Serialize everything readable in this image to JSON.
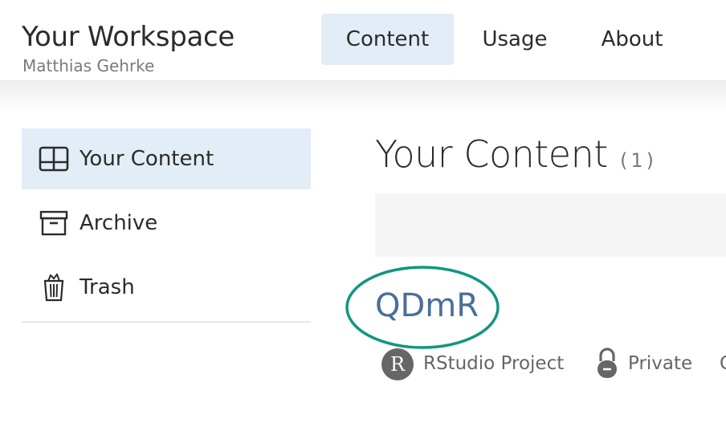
{
  "header": {
    "title": "Your Workspace",
    "user_name": "Matthias Gehrke",
    "tabs": [
      {
        "label": "Content",
        "active": true
      },
      {
        "label": "Usage",
        "active": false
      },
      {
        "label": "About",
        "active": false
      }
    ]
  },
  "sidebar": {
    "items": [
      {
        "label": "Your Content",
        "icon": "grid-window-icon",
        "active": true
      },
      {
        "label": "Archive",
        "icon": "archive-box-icon",
        "active": false
      },
      {
        "label": "Trash",
        "icon": "trash-can-icon",
        "active": false
      }
    ]
  },
  "main": {
    "title": "Your Content",
    "count": "(1)",
    "items": [
      {
        "title": "QDmR",
        "type_badge": "R",
        "type_label": "RStudio Project",
        "access_icon": "lock-icon",
        "access_label": "Private",
        "extra_label": "C"
      }
    ]
  },
  "colors": {
    "accent_bg": "#e3edf8",
    "link": "#4a6e99",
    "highlight": "#129683"
  }
}
